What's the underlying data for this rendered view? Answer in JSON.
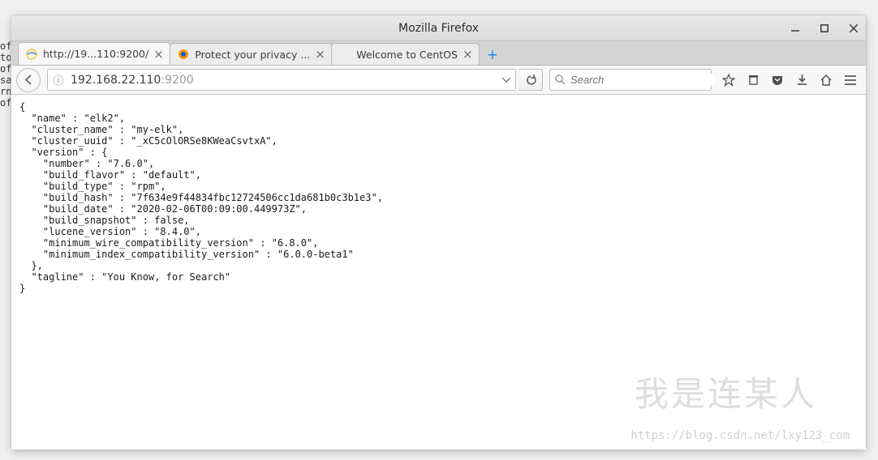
{
  "window": {
    "title": "Mozilla Firefox"
  },
  "tabs": [
    {
      "label": "http://19...110:9200/",
      "active": true
    },
    {
      "label": "Protect your privacy ...",
      "active": false
    },
    {
      "label": "Welcome to CentOS",
      "active": false
    }
  ],
  "urlbar": {
    "host": "192.168.22.110",
    "port": ":9200"
  },
  "searchbar": {
    "placeholder": "Search"
  },
  "page_json": {
    "name": "elk2",
    "cluster_name": "my-elk",
    "cluster_uuid": "_xC5cOlORSe8KWeaCsvtxA",
    "version": {
      "number": "7.6.0",
      "build_flavor": "default",
      "build_type": "rpm",
      "build_hash": "7f634e9f44834fbc12724506cc1da681b0c3b1e3",
      "build_date": "2020-02-06T00:09:00.449973Z",
      "build_snapshot": false,
      "lucene_version": "8.4.0",
      "minimum_wire_compatibility_version": "6.8.0",
      "minimum_index_compatibility_version": "6.0.0-beta1"
    },
    "tagline": "You Know, for Search"
  },
  "watermark": {
    "main": "我是连某人",
    "sub": "https://blog.csdn.net/lxy123_com"
  },
  "left_edge": [
    "of",
    "to",
    "of",
    "sa",
    "rn",
    " ",
    " ",
    " ",
    " ",
    " ",
    " ",
    " ",
    " ",
    "of"
  ]
}
